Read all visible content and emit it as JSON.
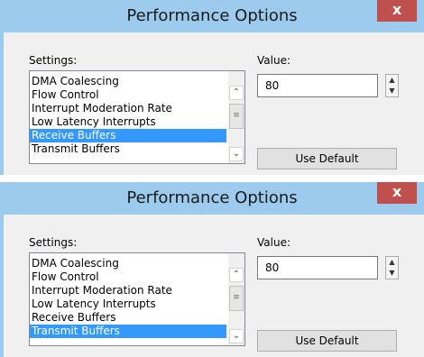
{
  "dialogs": [
    {
      "title": "Performance Options",
      "close_glyph": "x",
      "settings_label": "Settings:",
      "value_label": "Value:",
      "settings_items": [
        {
          "label": "DMA Coalescing",
          "selected": false
        },
        {
          "label": "Flow Control",
          "selected": false
        },
        {
          "label": "Interrupt Moderation Rate",
          "selected": false
        },
        {
          "label": "Low Latency Interrupts",
          "selected": false
        },
        {
          "label": "Receive Buffers",
          "selected": true
        },
        {
          "label": "Transmit Buffers",
          "selected": false
        }
      ],
      "value": "80",
      "use_default_label": "Use Default"
    },
    {
      "title": "Performance Options",
      "close_glyph": "x",
      "settings_label": "Settings:",
      "value_label": "Value:",
      "settings_items": [
        {
          "label": "DMA Coalescing",
          "selected": false
        },
        {
          "label": "Flow Control",
          "selected": false
        },
        {
          "label": "Interrupt Moderation Rate",
          "selected": false
        },
        {
          "label": "Low Latency Interrupts",
          "selected": false
        },
        {
          "label": "Receive Buffers",
          "selected": false
        },
        {
          "label": "Transmit Buffers",
          "selected": true
        }
      ],
      "value": "80",
      "use_default_label": "Use Default"
    }
  ],
  "icons": {
    "close": "close-icon",
    "scroll_up": "chevron-up-icon",
    "scroll_down": "chevron-down-icon",
    "scroll_thumb": "grip-icon",
    "spin_up": "spin-up-icon",
    "spin_down": "spin-down-icon"
  },
  "colors": {
    "titlebar": "#9ccbee",
    "close_button": "#c0504d",
    "selection": "#3399ff",
    "dialog_body": "#f0f0f0"
  }
}
